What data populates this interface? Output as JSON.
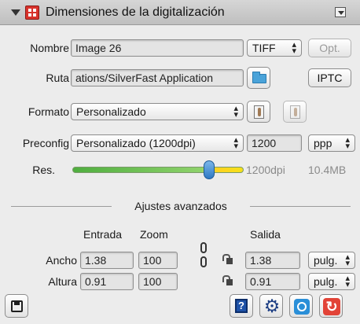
{
  "panel": {
    "title": "Dimensiones de la digitalización"
  },
  "name_row": {
    "label": "Nombre",
    "value": "Image 26",
    "format": "TIFF",
    "opt_label": "Opt."
  },
  "path_row": {
    "label": "Ruta",
    "value": "ations/SilverFast Application",
    "iptc_label": "IPTC"
  },
  "format_row": {
    "label": "Formato",
    "value": "Personalizado"
  },
  "preconfig_row": {
    "label": "Preconfig",
    "value": "Personalizado (1200dpi)",
    "resolution": "1200",
    "unit": "ppp"
  },
  "res_row": {
    "label": "Res.",
    "value_text": "1200dpi",
    "size_text": "10.4MB",
    "slider_level": 0.8
  },
  "advanced": {
    "title": "Ajustes avanzados",
    "col_input": "Entrada",
    "col_zoom": "Zoom",
    "col_output": "Salida",
    "width": {
      "label": "Ancho",
      "input": "1.38",
      "zoom": "100",
      "output": "1.38",
      "unit": "pulg."
    },
    "height": {
      "label": "Altura",
      "input": "0.91",
      "zoom": "100",
      "output": "0.91",
      "unit": "pulg."
    }
  },
  "colors": {
    "accent": "#2f79c3",
    "slider_green": "#4fae3f",
    "slider_yellow": "#ffd21f"
  },
  "icons": [
    "disclosure-triangle-icon",
    "scan-dimensions-icon",
    "panel-menu-icon",
    "folder-icon",
    "portrait-icon",
    "landscape-icon",
    "link-chain-icon",
    "lock-icon",
    "save-icon",
    "help-icon",
    "gear-icon",
    "quick-icon",
    "reset-icon"
  ]
}
